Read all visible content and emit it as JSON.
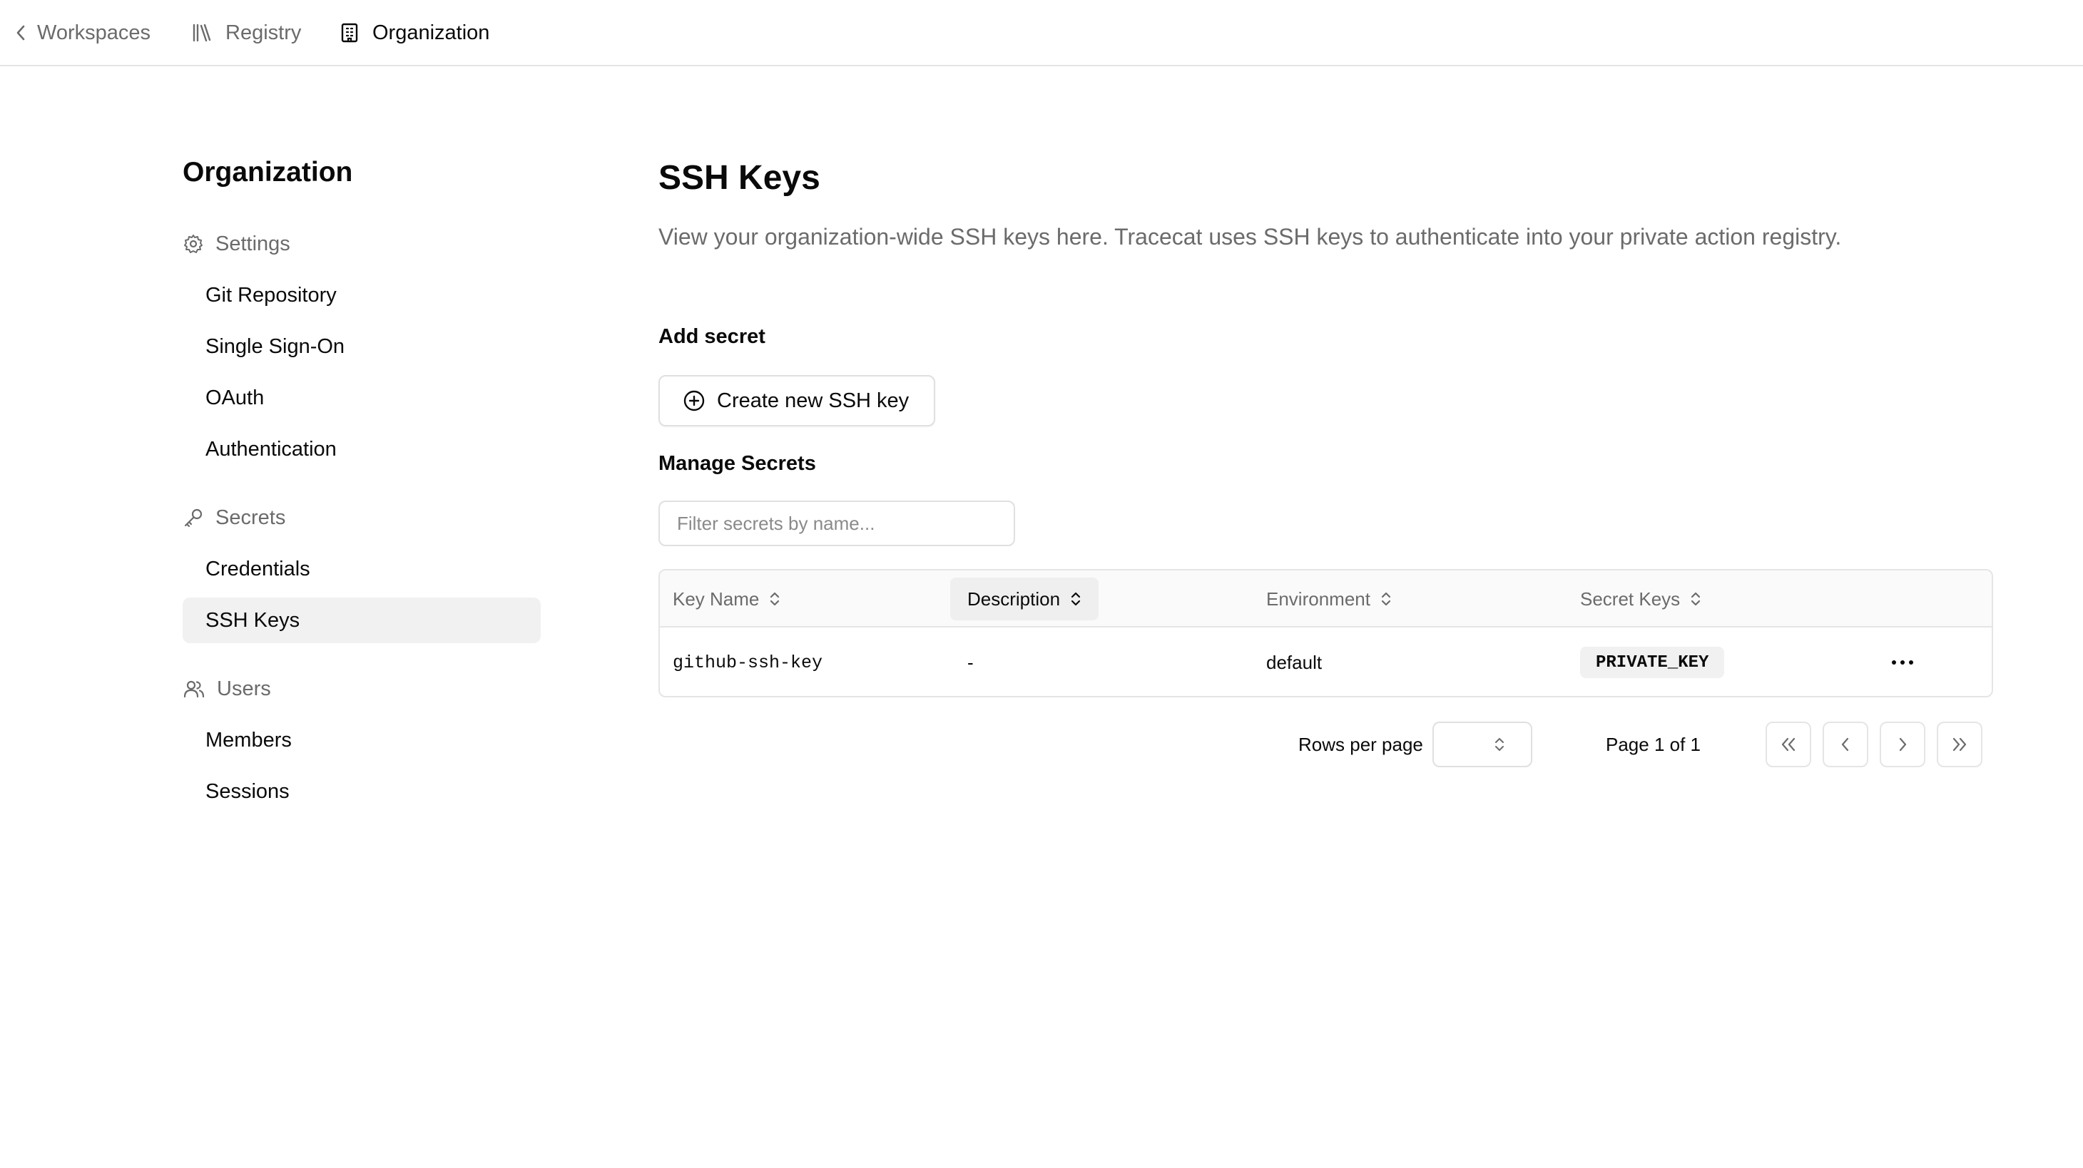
{
  "topnav": {
    "back_label": "Workspaces",
    "registry_label": "Registry",
    "organization_label": "Organization"
  },
  "sidebar": {
    "title": "Organization",
    "groups": [
      {
        "label": "Settings",
        "icon": "gear-icon",
        "items": [
          "Git Repository",
          "Single Sign-On",
          "OAuth",
          "Authentication"
        ]
      },
      {
        "label": "Secrets",
        "icon": "key-icon",
        "items": [
          "Credentials",
          "SSH Keys"
        ]
      },
      {
        "label": "Users",
        "icon": "users-icon",
        "items": [
          "Members",
          "Sessions"
        ]
      }
    ],
    "active_item": "SSH Keys"
  },
  "main": {
    "title": "SSH Keys",
    "description": "View your organization-wide SSH keys here. Tracecat uses SSH keys to authenticate into your private action registry.",
    "add_section_label": "Add secret",
    "create_button_label": "Create new SSH key",
    "manage_section_label": "Manage Secrets",
    "filter_placeholder": "Filter secrets by name...",
    "filter_value": ""
  },
  "table": {
    "columns": [
      "Key Name",
      "Description",
      "Environment",
      "Secret Keys"
    ],
    "rows": [
      {
        "key_name": "github-ssh-key",
        "description": "-",
        "environment": "default",
        "secret_keys": [
          "PRIVATE_KEY"
        ]
      }
    ]
  },
  "pagination": {
    "rows_per_page_label": "Rows per page",
    "rows_per_page_value": "",
    "page_info": "Page 1 of 1"
  },
  "colors": {
    "text": "#0a0a0a",
    "muted": "#6b6b6b",
    "border": "#e5e5e5",
    "active_bg": "#f1f1f1"
  }
}
